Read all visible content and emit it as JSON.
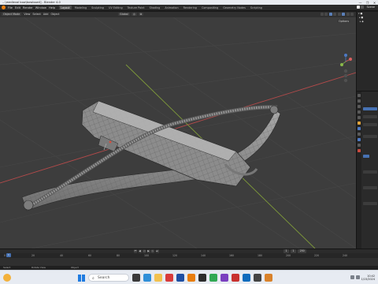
{
  "window": {
    "title": "...\\medieval bow\\bowbow4] - Blender 4.0",
    "controls": [
      "—",
      "❐",
      "✕"
    ]
  },
  "topbar": {
    "menus": [
      "File",
      "Edit",
      "Render",
      "Window",
      "Help"
    ],
    "tabs": [
      "Layout",
      "Modeling",
      "Sculpting",
      "UV Editing",
      "Texture Paint",
      "Shading",
      "Animation",
      "Rendering",
      "Compositing",
      "Geometry Nodes",
      "Scripting"
    ],
    "active_tab": "Layout",
    "scene": "Scene"
  },
  "viewport_header": {
    "mode": "Object Mode",
    "menus": [
      "View",
      "Select",
      "Add",
      "Object"
    ],
    "transform": "Global",
    "options": "Options"
  },
  "timeline": {
    "start": "1",
    "end": "250",
    "current": "1",
    "ruler_ticks": [
      "0",
      "20",
      "40",
      "60",
      "80",
      "100",
      "120",
      "140",
      "160",
      "180",
      "200",
      "220",
      "240"
    ],
    "cursor": "1"
  },
  "statusbar": {
    "left": "Select",
    "middle": "Rotate View",
    "right": "Object"
  },
  "taskbar": {
    "search_placeholder": "Search",
    "time": "10:42",
    "date": "1/15/2024"
  },
  "colors": {
    "accent": "#e87d0d",
    "viewport_bg": "#3d3d3d",
    "selection_blue": "#4772b3",
    "axis_x": "#b34a4a",
    "axis_y": "#7f9b3a"
  }
}
